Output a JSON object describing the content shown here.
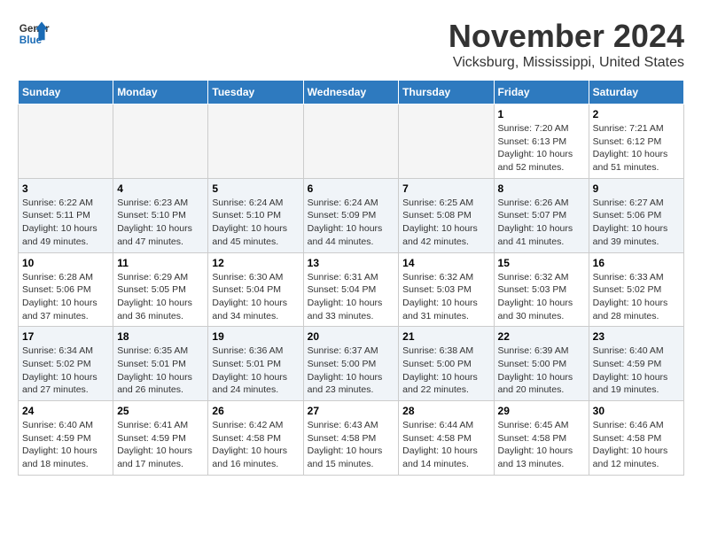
{
  "logo": {
    "general": "General",
    "blue": "Blue"
  },
  "header": {
    "month": "November 2024",
    "location": "Vicksburg, Mississippi, United States"
  },
  "weekdays": [
    "Sunday",
    "Monday",
    "Tuesday",
    "Wednesday",
    "Thursday",
    "Friday",
    "Saturday"
  ],
  "weeks": [
    [
      {
        "day": "",
        "info": ""
      },
      {
        "day": "",
        "info": ""
      },
      {
        "day": "",
        "info": ""
      },
      {
        "day": "",
        "info": ""
      },
      {
        "day": "",
        "info": ""
      },
      {
        "day": "1",
        "info": "Sunrise: 7:20 AM\nSunset: 6:13 PM\nDaylight: 10 hours\nand 52 minutes."
      },
      {
        "day": "2",
        "info": "Sunrise: 7:21 AM\nSunset: 6:12 PM\nDaylight: 10 hours\nand 51 minutes."
      }
    ],
    [
      {
        "day": "3",
        "info": "Sunrise: 6:22 AM\nSunset: 5:11 PM\nDaylight: 10 hours\nand 49 minutes."
      },
      {
        "day": "4",
        "info": "Sunrise: 6:23 AM\nSunset: 5:10 PM\nDaylight: 10 hours\nand 47 minutes."
      },
      {
        "day": "5",
        "info": "Sunrise: 6:24 AM\nSunset: 5:10 PM\nDaylight: 10 hours\nand 45 minutes."
      },
      {
        "day": "6",
        "info": "Sunrise: 6:24 AM\nSunset: 5:09 PM\nDaylight: 10 hours\nand 44 minutes."
      },
      {
        "day": "7",
        "info": "Sunrise: 6:25 AM\nSunset: 5:08 PM\nDaylight: 10 hours\nand 42 minutes."
      },
      {
        "day": "8",
        "info": "Sunrise: 6:26 AM\nSunset: 5:07 PM\nDaylight: 10 hours\nand 41 minutes."
      },
      {
        "day": "9",
        "info": "Sunrise: 6:27 AM\nSunset: 5:06 PM\nDaylight: 10 hours\nand 39 minutes."
      }
    ],
    [
      {
        "day": "10",
        "info": "Sunrise: 6:28 AM\nSunset: 5:06 PM\nDaylight: 10 hours\nand 37 minutes."
      },
      {
        "day": "11",
        "info": "Sunrise: 6:29 AM\nSunset: 5:05 PM\nDaylight: 10 hours\nand 36 minutes."
      },
      {
        "day": "12",
        "info": "Sunrise: 6:30 AM\nSunset: 5:04 PM\nDaylight: 10 hours\nand 34 minutes."
      },
      {
        "day": "13",
        "info": "Sunrise: 6:31 AM\nSunset: 5:04 PM\nDaylight: 10 hours\nand 33 minutes."
      },
      {
        "day": "14",
        "info": "Sunrise: 6:32 AM\nSunset: 5:03 PM\nDaylight: 10 hours\nand 31 minutes."
      },
      {
        "day": "15",
        "info": "Sunrise: 6:32 AM\nSunset: 5:03 PM\nDaylight: 10 hours\nand 30 minutes."
      },
      {
        "day": "16",
        "info": "Sunrise: 6:33 AM\nSunset: 5:02 PM\nDaylight: 10 hours\nand 28 minutes."
      }
    ],
    [
      {
        "day": "17",
        "info": "Sunrise: 6:34 AM\nSunset: 5:02 PM\nDaylight: 10 hours\nand 27 minutes."
      },
      {
        "day": "18",
        "info": "Sunrise: 6:35 AM\nSunset: 5:01 PM\nDaylight: 10 hours\nand 26 minutes."
      },
      {
        "day": "19",
        "info": "Sunrise: 6:36 AM\nSunset: 5:01 PM\nDaylight: 10 hours\nand 24 minutes."
      },
      {
        "day": "20",
        "info": "Sunrise: 6:37 AM\nSunset: 5:00 PM\nDaylight: 10 hours\nand 23 minutes."
      },
      {
        "day": "21",
        "info": "Sunrise: 6:38 AM\nSunset: 5:00 PM\nDaylight: 10 hours\nand 22 minutes."
      },
      {
        "day": "22",
        "info": "Sunrise: 6:39 AM\nSunset: 5:00 PM\nDaylight: 10 hours\nand 20 minutes."
      },
      {
        "day": "23",
        "info": "Sunrise: 6:40 AM\nSunset: 4:59 PM\nDaylight: 10 hours\nand 19 minutes."
      }
    ],
    [
      {
        "day": "24",
        "info": "Sunrise: 6:40 AM\nSunset: 4:59 PM\nDaylight: 10 hours\nand 18 minutes."
      },
      {
        "day": "25",
        "info": "Sunrise: 6:41 AM\nSunset: 4:59 PM\nDaylight: 10 hours\nand 17 minutes."
      },
      {
        "day": "26",
        "info": "Sunrise: 6:42 AM\nSunset: 4:58 PM\nDaylight: 10 hours\nand 16 minutes."
      },
      {
        "day": "27",
        "info": "Sunrise: 6:43 AM\nSunset: 4:58 PM\nDaylight: 10 hours\nand 15 minutes."
      },
      {
        "day": "28",
        "info": "Sunrise: 6:44 AM\nSunset: 4:58 PM\nDaylight: 10 hours\nand 14 minutes."
      },
      {
        "day": "29",
        "info": "Sunrise: 6:45 AM\nSunset: 4:58 PM\nDaylight: 10 hours\nand 13 minutes."
      },
      {
        "day": "30",
        "info": "Sunrise: 6:46 AM\nSunset: 4:58 PM\nDaylight: 10 hours\nand 12 minutes."
      }
    ]
  ]
}
